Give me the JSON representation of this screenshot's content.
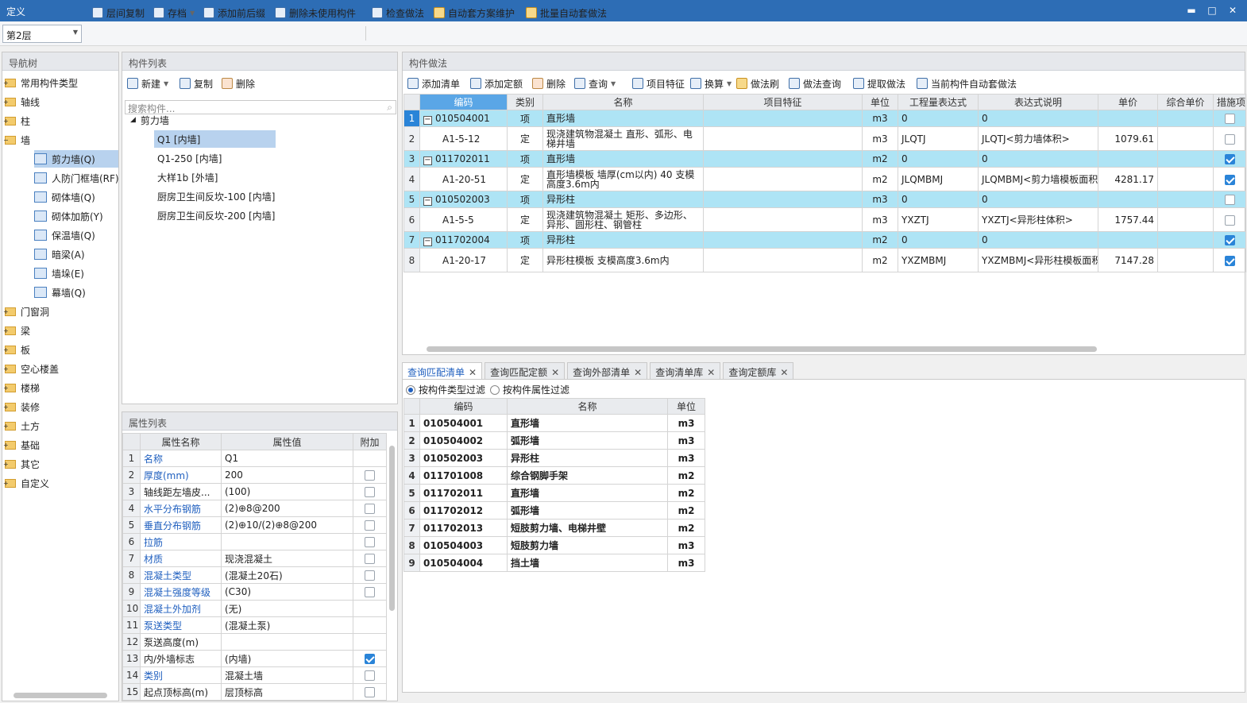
{
  "window": {
    "title": "定义",
    "minimize": "▬",
    "maximize": "□",
    "close": "✕"
  },
  "toolbar": {
    "floor": "第2层",
    "buttons": [
      "层间复制",
      "存档",
      "添加前后缀",
      "删除未使用构件",
      "检查做法",
      "自动套方案维护",
      "批量自动套做法"
    ]
  },
  "nav": {
    "title": "导航树",
    "items": [
      {
        "label": "常用构件类型"
      },
      {
        "label": "轴线"
      },
      {
        "label": "柱"
      },
      {
        "label": "墙"
      },
      {
        "label": "剪力墙(Q)"
      },
      {
        "label": "人防门框墙(RF)"
      },
      {
        "label": "砌体墙(Q)"
      },
      {
        "label": "砌体加筋(Y)"
      },
      {
        "label": "保温墙(Q)"
      },
      {
        "label": "暗梁(A)"
      },
      {
        "label": "墙垛(E)"
      },
      {
        "label": "幕墙(Q)"
      },
      {
        "label": "门窗洞"
      },
      {
        "label": "梁"
      },
      {
        "label": "板"
      },
      {
        "label": "空心楼盖"
      },
      {
        "label": "楼梯"
      },
      {
        "label": "装修"
      },
      {
        "label": "土方"
      },
      {
        "label": "基础"
      },
      {
        "label": "其它"
      },
      {
        "label": "自定义"
      }
    ]
  },
  "components": {
    "title": "构件列表",
    "new_label": "新建",
    "copy_label": "复制",
    "delete_label": "删除",
    "search_placeholder": "搜索构件...",
    "group": "剪力墙",
    "items": [
      "Q1 [内墙]",
      "Q1-250 [内墙]",
      "大样1b [外墙]",
      "厨房卫生间反坎-100 [内墙]",
      "厨房卫生间反坎-200 [内墙]"
    ]
  },
  "properties": {
    "title": "属性列表",
    "headers": [
      "属性名称",
      "属性值",
      "附加"
    ],
    "rows": [
      {
        "n": "1",
        "name": "名称",
        "value": "Q1",
        "blue": true,
        "cb": null
      },
      {
        "n": "2",
        "name": "厚度(mm)",
        "value": "200",
        "blue": true,
        "cb": false
      },
      {
        "n": "3",
        "name": "轴线距左墙皮...",
        "value": "(100)",
        "blue": false,
        "cb": false
      },
      {
        "n": "4",
        "name": "水平分布钢筋",
        "value": "(2)⊕8@200",
        "blue": true,
        "cb": false
      },
      {
        "n": "5",
        "name": "垂直分布钢筋",
        "value": "(2)⊕10/(2)⊕8@200",
        "blue": true,
        "cb": false
      },
      {
        "n": "6",
        "name": "拉筋",
        "value": "",
        "blue": true,
        "cb": false
      },
      {
        "n": "7",
        "name": "材质",
        "value": "现浇混凝土",
        "blue": true,
        "cb": false
      },
      {
        "n": "8",
        "name": "混凝土类型",
        "value": "(混凝土20石)",
        "blue": true,
        "cb": false
      },
      {
        "n": "9",
        "name": "混凝土强度等级",
        "value": "(C30)",
        "blue": true,
        "cb": false
      },
      {
        "n": "10",
        "name": "混凝土外加剂",
        "value": "(无)",
        "blue": true,
        "cb": null
      },
      {
        "n": "11",
        "name": "泵送类型",
        "value": "(混凝土泵)",
        "blue": true,
        "cb": null
      },
      {
        "n": "12",
        "name": "泵送高度(m)",
        "value": "",
        "blue": false,
        "cb": null
      },
      {
        "n": "13",
        "name": "内/外墙标志",
        "value": "(内墙)",
        "blue": false,
        "cb": true
      },
      {
        "n": "14",
        "name": "类别",
        "value": "混凝土墙",
        "blue": true,
        "cb": false
      },
      {
        "n": "15",
        "name": "起点顶标高(m)",
        "value": "层顶标高",
        "blue": false,
        "cb": false
      }
    ]
  },
  "method": {
    "title": "构件做法",
    "toolbar": [
      "添加清单",
      "添加定额",
      "删除",
      "查询",
      "项目特征",
      "换算",
      "做法刷",
      "做法查询",
      "提取做法",
      "当前构件自动套做法"
    ],
    "headers": [
      "编码",
      "类别",
      "名称",
      "项目特征",
      "单位",
      "工程量表达式",
      "表达式说明",
      "单价",
      "综合单价",
      "措施项"
    ],
    "rows": [
      {
        "n": "1",
        "code": "010504001",
        "type": "项",
        "name": "直形墙",
        "feature": "",
        "unit": "m3",
        "expr": "0",
        "desc": "0",
        "price": "",
        "cb": false,
        "hl": true
      },
      {
        "n": "2",
        "code": "A1-5-12",
        "type": "定",
        "name": "现浇建筑物混凝土 直形、弧形、电梯井墙",
        "feature": "",
        "unit": "m3",
        "expr": "JLQTJ",
        "desc": "JLQTJ<剪力墙体积>",
        "price": "1079.61",
        "cb": false,
        "hl": false
      },
      {
        "n": "3",
        "code": "011702011",
        "type": "项",
        "name": "直形墙",
        "feature": "",
        "unit": "m2",
        "expr": "0",
        "desc": "0",
        "price": "",
        "cb": true,
        "hl": true
      },
      {
        "n": "4",
        "code": "A1-20-51",
        "type": "定",
        "name": "直形墙模板 墙厚(cm以内) 40 支模高度3.6m内",
        "feature": "",
        "unit": "m2",
        "expr": "JLQMBMJ",
        "desc": "JLQMBMJ<剪力墙模板面积>",
        "price": "4281.17",
        "cb": true,
        "hl": false
      },
      {
        "n": "5",
        "code": "010502003",
        "type": "项",
        "name": "异形柱",
        "feature": "",
        "unit": "m3",
        "expr": "0",
        "desc": "0",
        "price": "",
        "cb": false,
        "hl": true
      },
      {
        "n": "6",
        "code": "A1-5-5",
        "type": "定",
        "name": "现浇建筑物混凝土 矩形、多边形、异形、圆形柱、钢管柱",
        "feature": "",
        "unit": "m3",
        "expr": "YXZTJ",
        "desc": "YXZTJ<异形柱体积>",
        "price": "1757.44",
        "cb": false,
        "hl": false
      },
      {
        "n": "7",
        "code": "011702004",
        "type": "项",
        "name": "异形柱",
        "feature": "",
        "unit": "m2",
        "expr": "0",
        "desc": "0",
        "price": "",
        "cb": true,
        "hl": true
      },
      {
        "n": "8",
        "code": "A1-20-17",
        "type": "定",
        "name": "异形柱模板 支模高度3.6m内",
        "feature": "",
        "unit": "m2",
        "expr": "YXZMBMJ",
        "desc": "YXZMBMJ<异形柱模板面积>",
        "price": "7147.28",
        "cb": true,
        "hl": false
      }
    ]
  },
  "query": {
    "tabs": [
      "查询匹配清单",
      "查询匹配定额",
      "查询外部清单",
      "查询清单库",
      "查询定额库"
    ],
    "filter1": "按构件类型过滤",
    "filter2": "按构件属性过滤",
    "headers": [
      "编码",
      "名称",
      "单位"
    ],
    "rows": [
      {
        "n": "1",
        "code": "010504001",
        "name": "直形墙",
        "unit": "m3"
      },
      {
        "n": "2",
        "code": "010504002",
        "name": "弧形墙",
        "unit": "m3"
      },
      {
        "n": "3",
        "code": "010502003",
        "name": "异形柱",
        "unit": "m3"
      },
      {
        "n": "4",
        "code": "011701008",
        "name": "综合钢脚手架",
        "unit": "m2"
      },
      {
        "n": "5",
        "code": "011702011",
        "name": "直形墙",
        "unit": "m2"
      },
      {
        "n": "6",
        "code": "011702012",
        "name": "弧形墙",
        "unit": "m2"
      },
      {
        "n": "7",
        "code": "011702013",
        "name": "短肢剪力墙、电梯井壁",
        "unit": "m2"
      },
      {
        "n": "8",
        "code": "010504003",
        "name": "短肢剪力墙",
        "unit": "m3"
      },
      {
        "n": "9",
        "code": "010504004",
        "name": "挡土墙",
        "unit": "m3"
      }
    ]
  }
}
